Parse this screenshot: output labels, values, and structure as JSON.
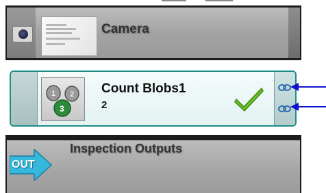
{
  "camera": {
    "title": "Camera",
    "icon": "camera-icon"
  },
  "count_blobs": {
    "title": "Count Blobs1",
    "value": "2",
    "status": "check-icon"
  },
  "inspection_outputs": {
    "title": "Inspection Outputs",
    "icon_label": "OUT"
  },
  "colors": {
    "accent_border": "#1e8c87",
    "arrow": "#1010d0",
    "check": "#6cc12a",
    "out_arrow": "#35b8dc"
  }
}
